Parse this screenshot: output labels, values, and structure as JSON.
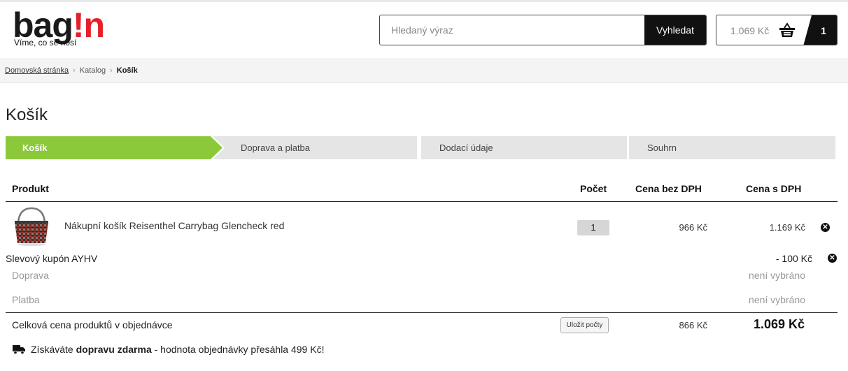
{
  "header": {
    "logo": {
      "text_main": "bag",
      "text_accent": "!n",
      "tagline": "Víme, co se nosí"
    },
    "search": {
      "placeholder": "Hledaný výraz",
      "value": "",
      "button_label": "Vyhledat"
    },
    "cart": {
      "price": "1.069 Kč",
      "count": "1",
      "icon": "basket-icon"
    }
  },
  "breadcrumb": {
    "items": [
      "Domovská stránka",
      "Katalog",
      "Košík"
    ]
  },
  "page": {
    "title": "Košík"
  },
  "steps": [
    "Košík",
    "Doprava a platba",
    "Dodací údaje",
    "Souhrn"
  ],
  "table": {
    "headers": {
      "product": "Produkt",
      "qty": "Počet",
      "price_ex_vat": "Cena bez DPH",
      "price_vat": "Cena s DPH"
    },
    "items": [
      {
        "name": "Nákupní košík Reisenthel Carrybag Glencheck red",
        "qty": "1",
        "price_ex_vat": "966 Kč",
        "price_vat": "1.169 Kč"
      }
    ],
    "coupon": {
      "label": "Slevový kupón AYHV",
      "value": "- 100 Kč"
    },
    "shipping": {
      "label": "Doprava",
      "value": "není vybráno"
    },
    "payment": {
      "label": "Platba",
      "value": "není vybráno"
    },
    "total": {
      "label": "Celková cena produktů v objednávce",
      "save_button": "Uložit počty",
      "price_ex_vat": "866 Kč",
      "price_vat": "1.069 Kč"
    }
  },
  "free_shipping": {
    "prefix": "Získáváte ",
    "bold": "dopravu zdarma",
    "suffix": " - hodnota objednávky přesáhla 499 Kč!"
  },
  "colors": {
    "accent": "#8bc93b",
    "brand_red": "#e4202a",
    "dark": "#111111"
  }
}
